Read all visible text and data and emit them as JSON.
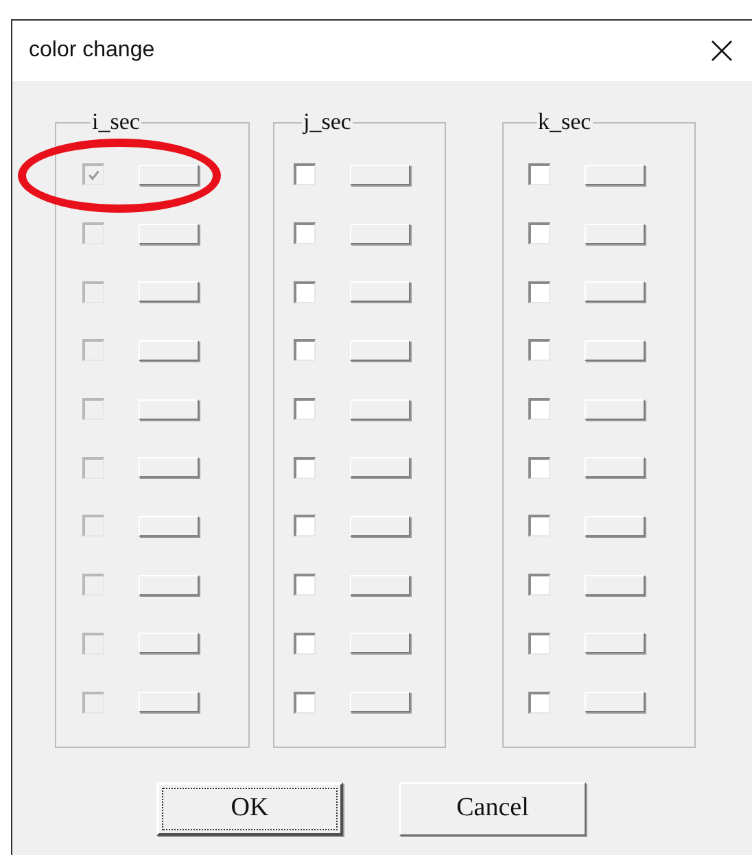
{
  "window": {
    "title": "color change"
  },
  "sections": [
    {
      "label": "i_sec",
      "rows": [
        {
          "checked": true,
          "disabled": true,
          "circled": true
        },
        {
          "checked": false,
          "disabled": true,
          "circled": false
        },
        {
          "checked": false,
          "disabled": true,
          "circled": false
        },
        {
          "checked": false,
          "disabled": true,
          "circled": false
        },
        {
          "checked": false,
          "disabled": true,
          "circled": false
        },
        {
          "checked": false,
          "disabled": true,
          "circled": false
        },
        {
          "checked": false,
          "disabled": true,
          "circled": false
        },
        {
          "checked": false,
          "disabled": true,
          "circled": false
        },
        {
          "checked": false,
          "disabled": true,
          "circled": false
        },
        {
          "checked": false,
          "disabled": true,
          "circled": false
        }
      ]
    },
    {
      "label": "j_sec",
      "rows": [
        {
          "checked": false,
          "disabled": false,
          "circled": false
        },
        {
          "checked": false,
          "disabled": false,
          "circled": false
        },
        {
          "checked": false,
          "disabled": false,
          "circled": false
        },
        {
          "checked": false,
          "disabled": false,
          "circled": false
        },
        {
          "checked": false,
          "disabled": false,
          "circled": false
        },
        {
          "checked": false,
          "disabled": false,
          "circled": false
        },
        {
          "checked": false,
          "disabled": false,
          "circled": false
        },
        {
          "checked": false,
          "disabled": false,
          "circled": false
        },
        {
          "checked": false,
          "disabled": false,
          "circled": false
        },
        {
          "checked": false,
          "disabled": false,
          "circled": false
        }
      ]
    },
    {
      "label": "k_sec",
      "rows": [
        {
          "checked": false,
          "disabled": false,
          "circled": false
        },
        {
          "checked": false,
          "disabled": false,
          "circled": false
        },
        {
          "checked": false,
          "disabled": false,
          "circled": false
        },
        {
          "checked": false,
          "disabled": false,
          "circled": false
        },
        {
          "checked": false,
          "disabled": false,
          "circled": false
        },
        {
          "checked": false,
          "disabled": false,
          "circled": false
        },
        {
          "checked": false,
          "disabled": false,
          "circled": false
        },
        {
          "checked": false,
          "disabled": false,
          "circled": false
        },
        {
          "checked": false,
          "disabled": false,
          "circled": false
        },
        {
          "checked": false,
          "disabled": false,
          "circled": false
        }
      ]
    }
  ],
  "buttons": [
    {
      "label": "OK",
      "default": true
    },
    {
      "label": "Cancel",
      "default": false
    }
  ]
}
